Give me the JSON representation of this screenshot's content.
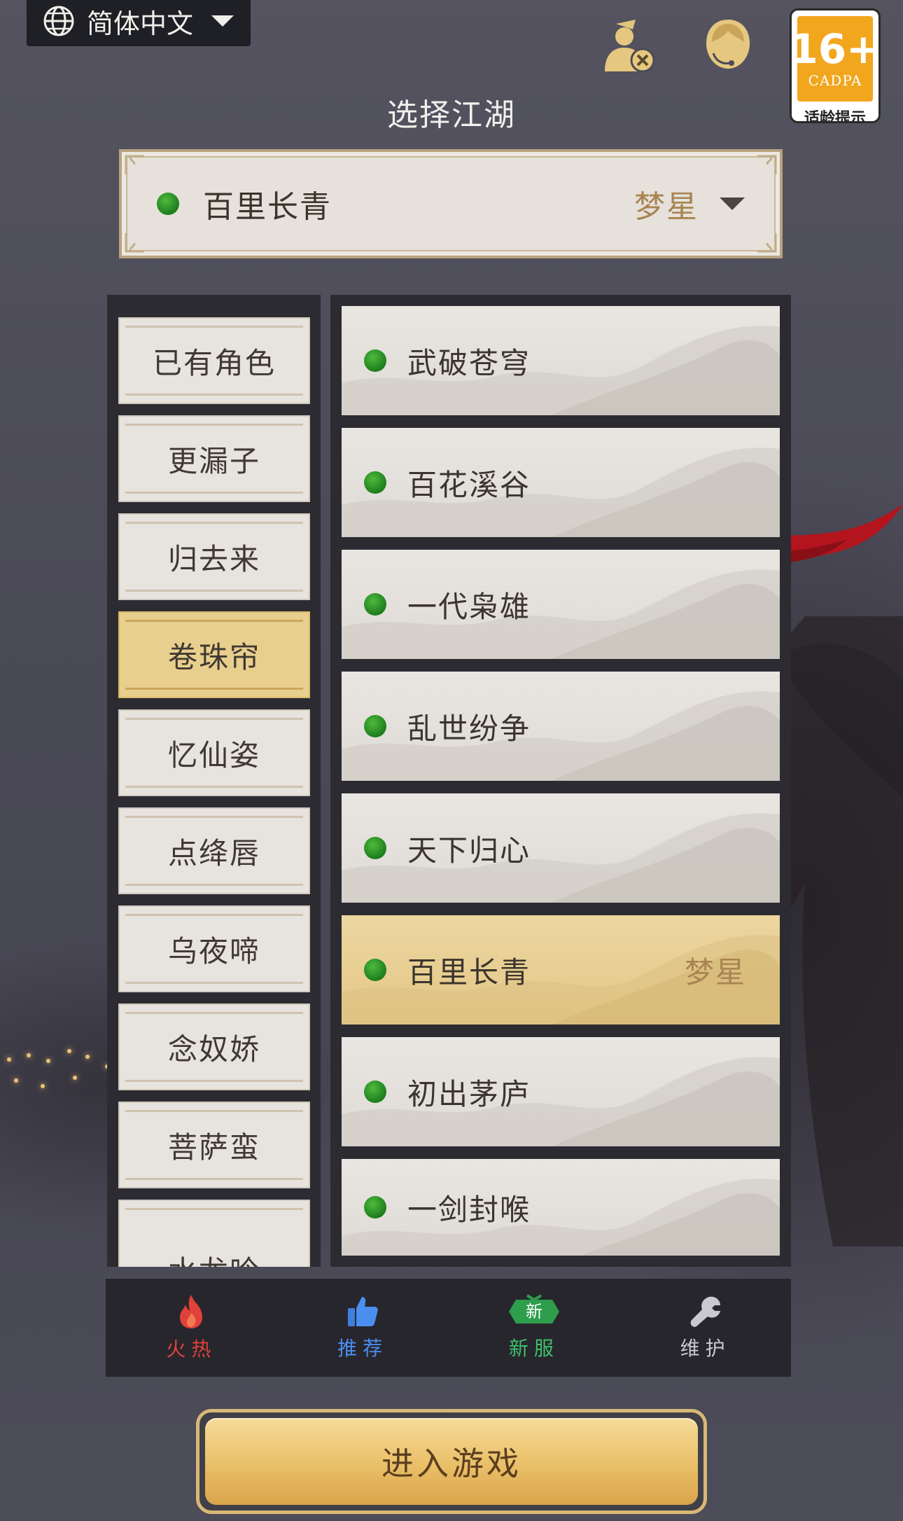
{
  "language": {
    "label": "简体中文",
    "icon": "globe-icon"
  },
  "header": {
    "title": "选择江湖",
    "icons": [
      "account-switch-icon",
      "customer-service-icon"
    ],
    "age_badge": {
      "rating": "16+",
      "org": "CADPA",
      "tip": "适龄提示"
    }
  },
  "current_server": {
    "name": "百里长青",
    "tag": "梦星",
    "status": "online"
  },
  "categories": [
    {
      "label": "已有角色",
      "active": false
    },
    {
      "label": "更漏子",
      "active": false
    },
    {
      "label": "归去来",
      "active": false
    },
    {
      "label": "卷珠帘",
      "active": true
    },
    {
      "label": "忆仙姿",
      "active": false
    },
    {
      "label": "点绛唇",
      "active": false
    },
    {
      "label": "乌夜啼",
      "active": false
    },
    {
      "label": "念奴娇",
      "active": false
    },
    {
      "label": "菩萨蛮",
      "active": false
    },
    {
      "label": "水龙吟",
      "active": false
    }
  ],
  "servers": [
    {
      "name": "武破苍穹",
      "tag": "",
      "active": false
    },
    {
      "name": "百花溪谷",
      "tag": "",
      "active": false
    },
    {
      "name": "一代枭雄",
      "tag": "",
      "active": false
    },
    {
      "name": "乱世纷争",
      "tag": "",
      "active": false
    },
    {
      "name": "天下归心",
      "tag": "",
      "active": false
    },
    {
      "name": "百里长青",
      "tag": "梦星",
      "active": true
    },
    {
      "name": "初出茅庐",
      "tag": "",
      "active": false
    },
    {
      "name": "一剑封喉",
      "tag": "",
      "active": false
    }
  ],
  "tabs": [
    {
      "label": "火热",
      "icon": "fire-icon",
      "color": "#e0413a"
    },
    {
      "label": "推荐",
      "icon": "thumbs-up-icon",
      "color": "#4a8ff0"
    },
    {
      "label": "新服",
      "icon": "new-badge-icon",
      "badge": "新",
      "color": "#3fc06a"
    },
    {
      "label": "维护",
      "icon": "wrench-icon",
      "color": "#c9c9cf"
    }
  ],
  "enter_button": {
    "label": "进入游戏"
  },
  "colors": {
    "online_dot": "#2a9a2a",
    "active_gold": "#e9cf8e",
    "tag_color": "#a88452"
  }
}
